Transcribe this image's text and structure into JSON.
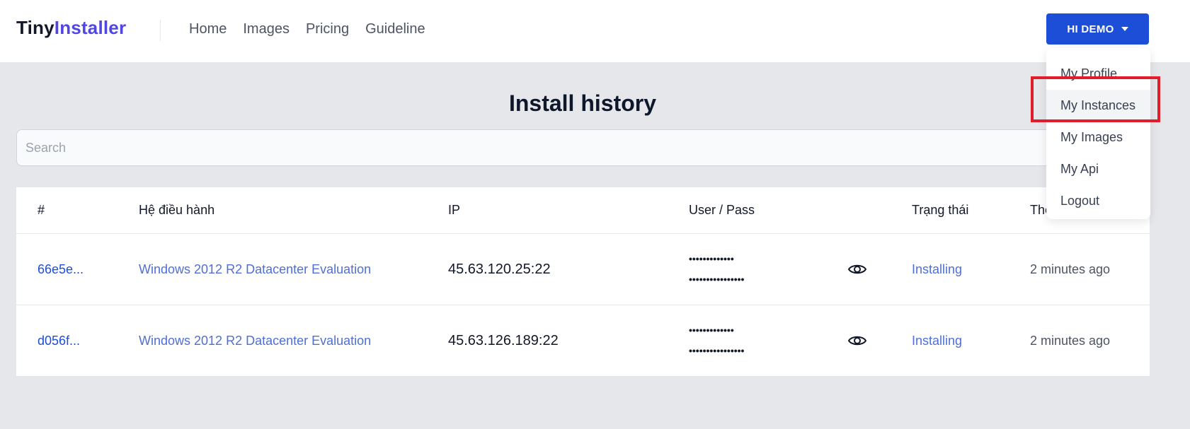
{
  "brand": {
    "part1": "Tiny",
    "part2": "Installer",
    "color_primary": "#4f46e5"
  },
  "nav": {
    "items": [
      "Home",
      "Images",
      "Pricing",
      "Guideline"
    ]
  },
  "user_menu": {
    "button_label": "HI DEMO",
    "items": [
      "My Profile",
      "My Instances",
      "My Images",
      "My Api",
      "Logout"
    ],
    "highlighted": "My Instances"
  },
  "page": {
    "title": "Install history"
  },
  "search": {
    "placeholder": "Search",
    "value": ""
  },
  "table": {
    "headers": [
      "#",
      "Hệ điều hành",
      "IP",
      "User / Pass",
      "Trạng thái",
      "Thờ"
    ],
    "rows": [
      {
        "id": "66e5e...",
        "os": "Windows 2012 R2 Datacenter Evaluation",
        "ip": "45.63.120.25:22",
        "user_masked": "•••••••••••••",
        "pass_masked": "••••••••••••••••",
        "status": "Installing",
        "time": "2 minutes ago"
      },
      {
        "id": "d056f...",
        "os": "Windows 2012 R2 Datacenter Evaluation",
        "ip": "45.63.126.189:22",
        "user_masked": "•••••••••••••",
        "pass_masked": "••••••••••••••••",
        "status": "Installing",
        "time": "2 minutes ago"
      }
    ]
  },
  "colors": {
    "accent": "#1d4ed8",
    "link": "#4f6fd6",
    "highlight": "#e11d2b",
    "background": "#e5e7eb"
  }
}
